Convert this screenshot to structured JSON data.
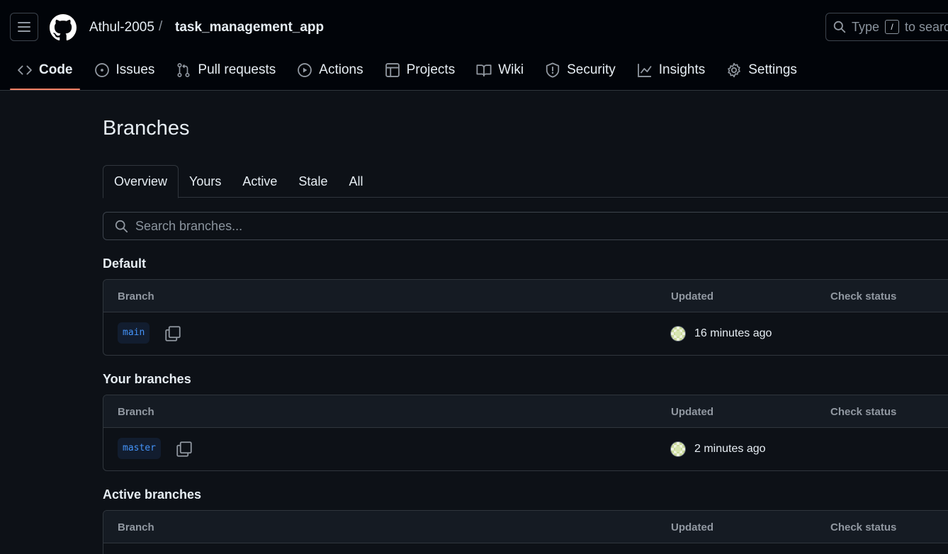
{
  "header": {
    "owner": "Athul-2005",
    "separator": "/",
    "repo": "task_management_app",
    "search_prefix": "Type",
    "search_key": "/",
    "search_suffix": "to search"
  },
  "nav": [
    {
      "label": "Code",
      "icon": "code-icon"
    },
    {
      "label": "Issues",
      "icon": "issue-icon"
    },
    {
      "label": "Pull requests",
      "icon": "pull-request-icon"
    },
    {
      "label": "Actions",
      "icon": "play-icon"
    },
    {
      "label": "Projects",
      "icon": "table-icon"
    },
    {
      "label": "Wiki",
      "icon": "book-icon"
    },
    {
      "label": "Security",
      "icon": "shield-icon"
    },
    {
      "label": "Insights",
      "icon": "graph-icon"
    },
    {
      "label": "Settings",
      "icon": "gear-icon"
    }
  ],
  "page": {
    "title": "Branches",
    "tabs": [
      "Overview",
      "Yours",
      "Active",
      "Stale",
      "All"
    ],
    "search_placeholder": "Search branches..."
  },
  "sections": [
    {
      "title": "Default",
      "headers": {
        "branch": "Branch",
        "updated": "Updated",
        "check": "Check status"
      },
      "rows": [
        {
          "branch": "main",
          "updated": "16 minutes ago"
        }
      ]
    },
    {
      "title": "Your branches",
      "headers": {
        "branch": "Branch",
        "updated": "Updated",
        "check": "Check status"
      },
      "rows": [
        {
          "branch": "master",
          "updated": "2 minutes ago"
        }
      ]
    },
    {
      "title": "Active branches",
      "headers": {
        "branch": "Branch",
        "updated": "Updated",
        "check": "Check status"
      },
      "rows": []
    }
  ],
  "colors": {
    "accent": "#f78166",
    "branch_link": "#4493f8",
    "background": "#0d1117"
  }
}
